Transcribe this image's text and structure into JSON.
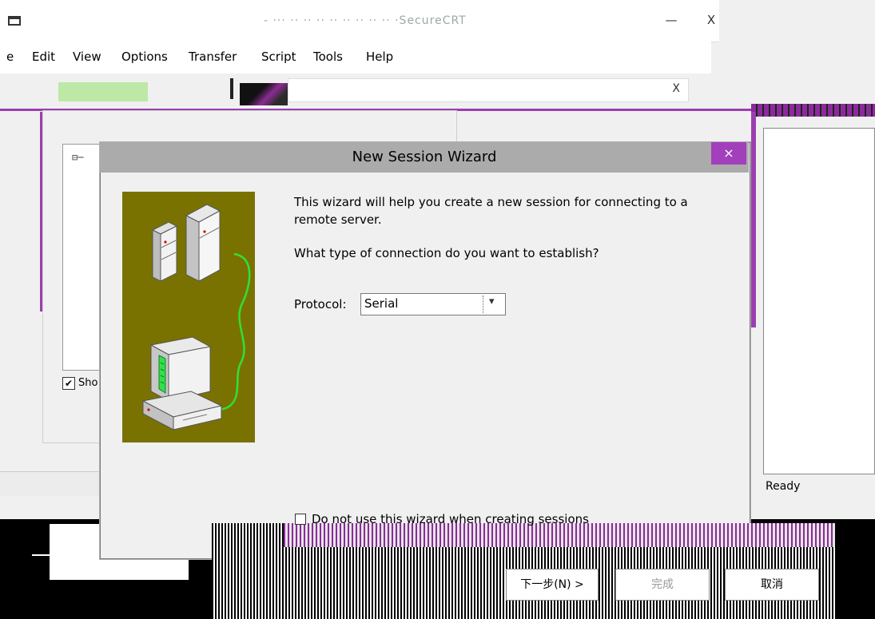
{
  "app": {
    "title": "- ··· ·· ·· ·· ·· ·· ·· ·· ·· ·SecureCRT",
    "status": "Ready",
    "window_controls": {
      "minimize": "—",
      "close": "X"
    },
    "menu": [
      "e",
      "Edit",
      "View",
      "Options",
      "Transfer",
      "Script",
      "Tools",
      "Help"
    ],
    "session_tree_expander": "⊟─",
    "show_label": "Sho",
    "dialog_close": "X"
  },
  "wizard": {
    "title": "New Session Wizard",
    "close": "×",
    "intro": "This wizard will help you create a new session for connecting to a remote server.",
    "question": "What type of connection do you want to establish?",
    "protocol_label": "Protocol:",
    "protocol_value": "Serial",
    "dont_use_label": "Do not use this wizard when creating sessions",
    "buttons": {
      "next": "下一步(N) >",
      "finish": "完成",
      "cancel": "取消"
    }
  },
  "colors": {
    "accent": "#a23fbb",
    "wizard_image_bg": "#7a7200",
    "screen_green": "#32e04a"
  }
}
